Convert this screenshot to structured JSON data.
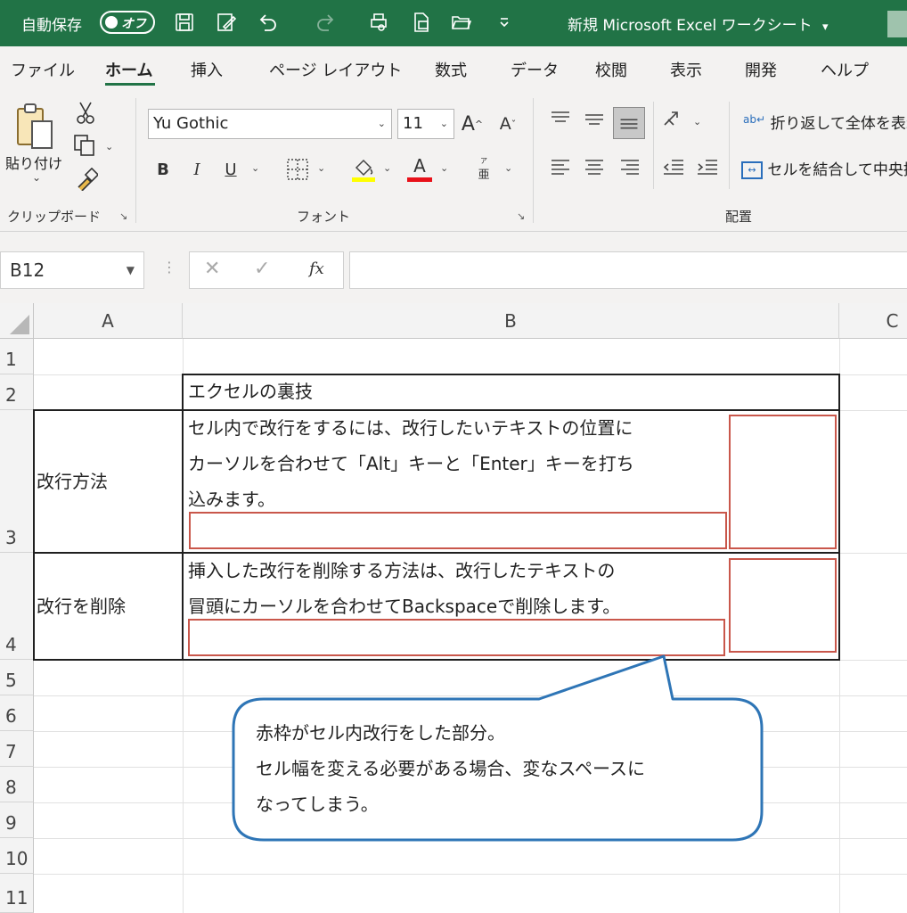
{
  "titlebar": {
    "autosave_label": "自動保存",
    "autosave_state": "オフ",
    "doc_title": "新規 Microsoft Excel ワークシート",
    "doc_title_arrow": "▾",
    "quick_access_icons": [
      "save-icon",
      "edit-icon",
      "undo-icon",
      "redo-icon",
      "print-preview-icon",
      "pdf-icon",
      "open-folder-icon",
      "customize-icon"
    ]
  },
  "tabs": [
    "ファイル",
    "ホーム",
    "挿入",
    "ページ レイアウト",
    "数式",
    "データ",
    "校閲",
    "表示",
    "開発",
    "ヘルプ"
  ],
  "active_tab": "ホーム",
  "ribbon": {
    "clipboard": {
      "paste_label": "貼り付け",
      "paste_arrow": "⌄",
      "group_label": "クリップボード",
      "launcher": "↘"
    },
    "font": {
      "font_name": "Yu Gothic",
      "font_size": "11",
      "bold": "B",
      "italic": "I",
      "underline": "U",
      "grow": "A",
      "shrink": "A",
      "font_color_glyph": "A",
      "furigana_glyph": "亜",
      "group_label": "フォント",
      "launcher": "↘"
    },
    "alignment": {
      "wrap_text_label": "折り返して全体を表示",
      "merge_center_label": "セルを結合して中央揃え",
      "group_label": "配置"
    },
    "colors": {
      "highlight": "#ffff00",
      "font_color": "#e8111a",
      "excel_green": "#217346"
    }
  },
  "formula_bar": {
    "name_box": "B12",
    "cancel": "✕",
    "enter": "✓",
    "fx": "fx",
    "formula": ""
  },
  "sheet": {
    "columns": [
      "A",
      "B",
      "C"
    ],
    "rows": [
      "1",
      "2",
      "3",
      "4",
      "5",
      "6",
      "7",
      "8",
      "9",
      "10",
      "11"
    ],
    "cells": {
      "B2": "エクセルの裏技",
      "A3": "改行方法",
      "B3_lines": [
        "セル内で改行をするには、改行したいテキストの位置に",
        "カーソルを合わせて「Alt」キーと「Enter」キーを打ち",
        "込みます。"
      ],
      "A4": "改行を削除",
      "B4_lines": [
        "挿入した改行を削除する方法は、改行したテキストの",
        "冒頭にカーソルを合わせてBackspaceで削除します。"
      ]
    },
    "annotation_color": "#c0392b",
    "callout": {
      "lines": [
        "赤枠がセル内改行をした部分。",
        "セル幅を変える必要がある場合、変なスペースに",
        "なってしまう。"
      ],
      "border_color": "#2e75b6"
    }
  }
}
